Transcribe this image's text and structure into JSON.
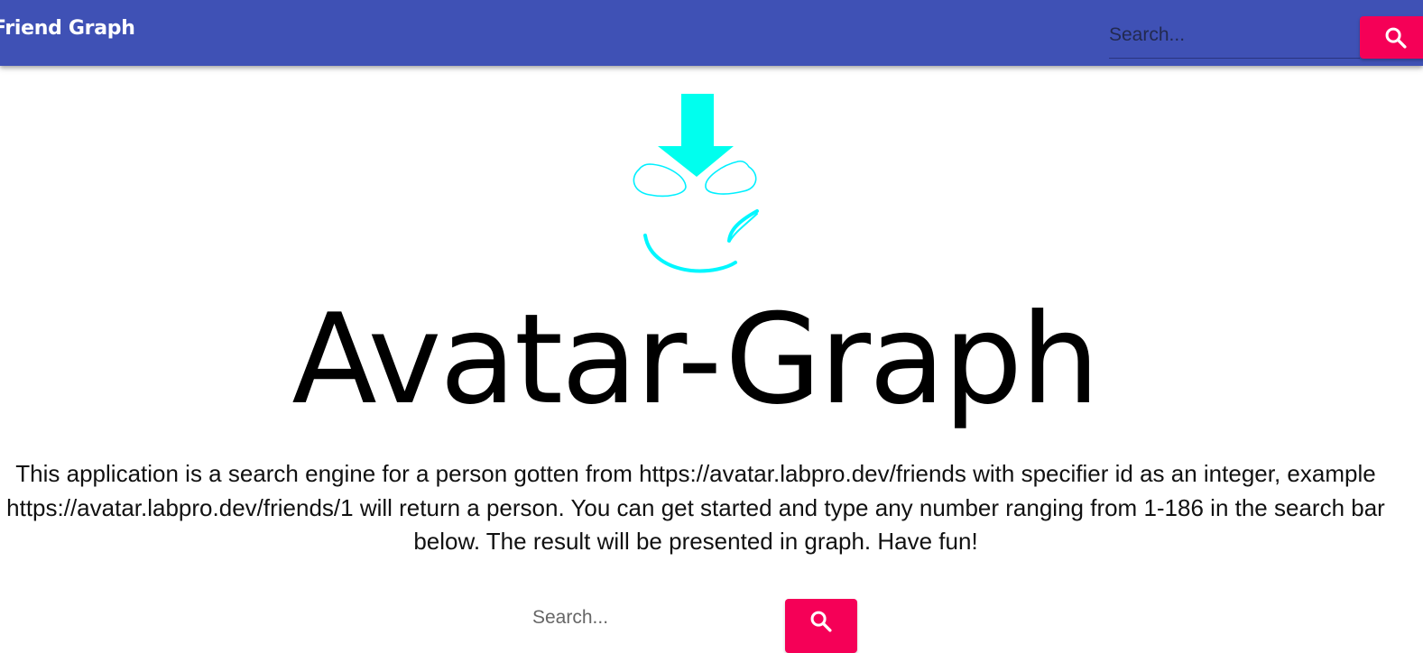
{
  "header": {
    "brand": "Friend Graph",
    "search_placeholder": "Search...",
    "search_icon": "search-icon"
  },
  "hero": {
    "logo_icon": "avatar-logo-icon",
    "title": "Avatar-Graph",
    "description": "This application is a search engine for a person gotten from https://avatar.labpro.dev/friends with specifier id as an integer, example https://avatar.labpro.dev/friends/1 will return a person. You can get started and type any number ranging from 1-186 in the search bar below. The result will be presented in graph. Have fun!"
  },
  "main_search": {
    "placeholder": "Search...",
    "search_icon": "search-icon"
  },
  "colors": {
    "appbar": "#3f51b5",
    "accent": "#f50057",
    "logo": "#00ffee"
  }
}
